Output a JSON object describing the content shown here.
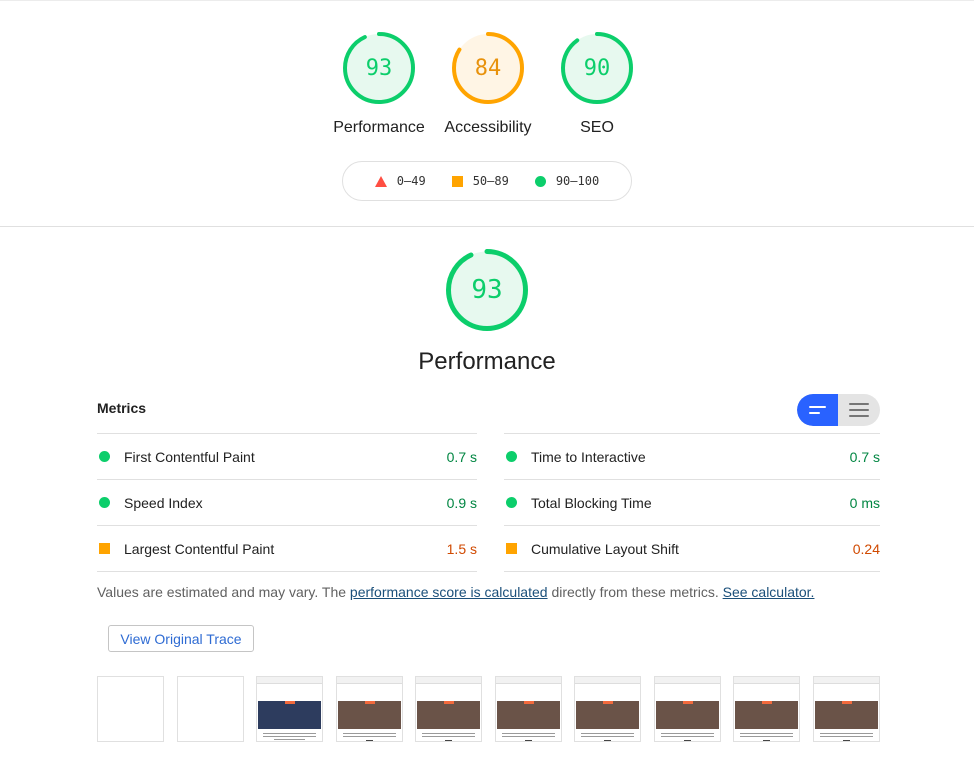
{
  "scores": [
    {
      "name": "Performance",
      "score": 93,
      "status": "pass"
    },
    {
      "name": "Accessibility",
      "score": 84,
      "status": "average"
    },
    {
      "name": "SEO",
      "score": 90,
      "status": "pass"
    }
  ],
  "legend": {
    "fail": "0–49",
    "average": "50–89",
    "pass": "90–100"
  },
  "performance": {
    "score": 93,
    "title": "Performance"
  },
  "metrics": {
    "title": "Metrics",
    "left": [
      {
        "name": "First Contentful Paint",
        "value": "0.7 s",
        "status": "pass"
      },
      {
        "name": "Speed Index",
        "value": "0.9 s",
        "status": "pass"
      },
      {
        "name": "Largest Contentful Paint",
        "value": "1.5 s",
        "status": "average"
      }
    ],
    "right": [
      {
        "name": "Time to Interactive",
        "value": "0.7 s",
        "status": "pass"
      },
      {
        "name": "Total Blocking Time",
        "value": "0 ms",
        "status": "pass"
      },
      {
        "name": "Cumulative Layout Shift",
        "value": "0.24",
        "status": "average"
      }
    ]
  },
  "note": {
    "prefix": "Values are estimated and may vary. The ",
    "link1": "performance score is calculated",
    "middle": " directly from these metrics. ",
    "link2": "See calculator."
  },
  "trace_button": "View Original Trace",
  "colors": {
    "pass": "#0cce6b",
    "average": "#ffa400",
    "fail": "#ff4e42",
    "toggle_active": "#2962ff"
  },
  "filmstrip": [
    "blank",
    "blank",
    "blue",
    "brown",
    "brown",
    "brown",
    "brown",
    "brown",
    "brown",
    "brown"
  ]
}
